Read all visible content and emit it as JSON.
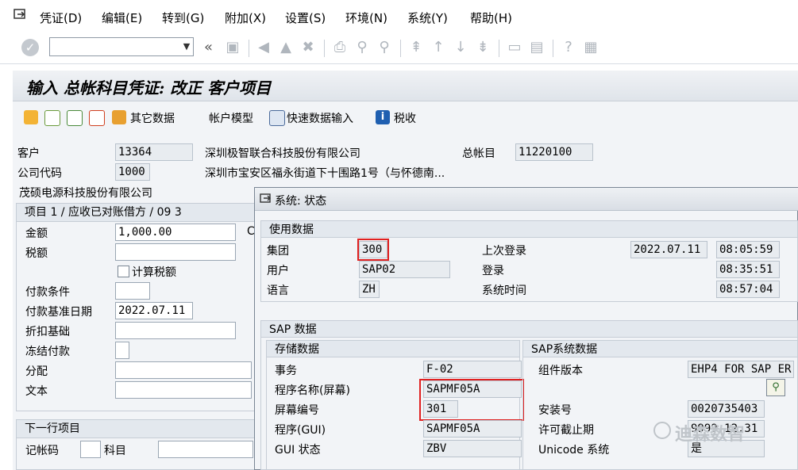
{
  "menu": [
    "凭证(D)",
    "编辑(E)",
    "转到(G)",
    "附加(X)",
    "设置(S)",
    "环境(N)",
    "系统(Y)",
    "帮助(H)"
  ],
  "title": "输入 总帐科目凭证: 改正 客户项目",
  "app_toolbar": {
    "other_data": "其它数据",
    "account_model": "帐户模型",
    "fast_entry": "快速数据输入",
    "tax": "税收"
  },
  "header": {
    "customer_label": "客户",
    "customer_value": "13364",
    "customer_name": "深圳极智联合科技股份有限公司",
    "gl_label": "总帐目",
    "gl_value": "11220100",
    "company_code_label": "公司代码",
    "company_code_value": "1000",
    "address": "深圳市宝安区福永街道下十围路1号（与怀德南...",
    "company_name": "茂硕电源科技股份有限公司"
  },
  "item": {
    "group_title": "项目 1 / 应收已对账借方 / 09 3",
    "amount_label": "金额",
    "amount_value": "1,000.00",
    "amount_suffix": "C",
    "tax_label": "税额",
    "tax_value": "",
    "calc_tax_label": "计算税额",
    "payment_terms_label": "付款条件",
    "payment_terms_value": "",
    "baseline_date_label": "付款基准日期",
    "baseline_date_value": "2022.07.11",
    "discount_base_label": "折扣基础",
    "discount_base_value": "",
    "pmt_block_label": "冻结付款",
    "pmt_block_value": "",
    "assignment_label": "分配",
    "assignment_value": "",
    "text_label": "文本",
    "text_value": ""
  },
  "next_item": {
    "group_title": "下一行项目",
    "posting_key_label": "记帐码",
    "posting_key_value": "",
    "account_label": "科目",
    "account_value": ""
  },
  "dialog": {
    "title": "系统: 状态",
    "usage_title": "使用数据",
    "client_label": "集团",
    "client_value": "300",
    "user_label": "用户",
    "user_value": "SAP02",
    "language_label": "语言",
    "language_value": "ZH",
    "last_logon_label": "上次登录",
    "last_logon_date": "2022.07.11",
    "last_logon_time": "08:05:59",
    "logon_label": "登录",
    "logon_time": "08:35:51",
    "system_time_label": "系统时间",
    "system_time_value": "08:57:04",
    "sap_data_title": "SAP 数据",
    "repo_title": "存储数据",
    "transaction_label": "事务",
    "transaction_value": "F-02",
    "program_screen_label": "程序名称(屏幕)",
    "program_screen_value": "SAPMF05A",
    "screen_no_label": "屏幕编号",
    "screen_no_value": "301",
    "program_gui_label": "程序(GUI)",
    "program_gui_value": "SAPMF05A",
    "gui_status_label": "GUI 状态",
    "gui_status_value": "ZBV",
    "sap_system_title": "SAP系统数据",
    "component_label": "组件版本",
    "component_value": "EHP4 FOR SAP ER...",
    "install_no_label": "安装号",
    "install_no_value": "0020735403",
    "license_exp_label": "许可截止期",
    "license_exp_value": "9999.12.31",
    "unicode_label": "Unicode 系统",
    "unicode_value": "是"
  },
  "watermark": "迪森数智",
  "colors": {
    "highlight": "#e02020"
  }
}
